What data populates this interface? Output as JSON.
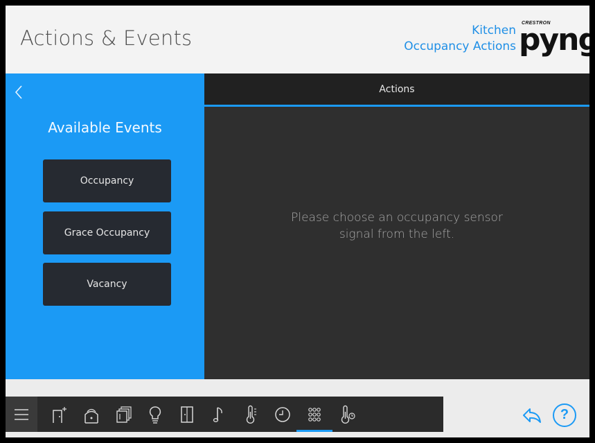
{
  "header": {
    "title": "Actions & Events",
    "room": "Kitchen",
    "subtitle": "Occupancy Actions",
    "logo_small": "CRESTRON",
    "logo_big": "pyng"
  },
  "left_panel": {
    "back_icon": "chevron-left-icon",
    "title": "Available Events",
    "events": [
      {
        "label": "Occupancy"
      },
      {
        "label": "Grace Occupancy"
      },
      {
        "label": "Vacancy"
      }
    ]
  },
  "right_panel": {
    "tab": "Actions",
    "message_line1": "Please choose an occupancy sensor",
    "message_line2": "signal from the left."
  },
  "bottom_nav": {
    "items": [
      {
        "icon": "menu-icon"
      },
      {
        "icon": "door-add-icon"
      },
      {
        "icon": "garage-icon"
      },
      {
        "icon": "shades-icon"
      },
      {
        "icon": "lightbulb-icon"
      },
      {
        "icon": "door-icon"
      },
      {
        "icon": "music-note-icon"
      },
      {
        "icon": "thermometer-icon"
      },
      {
        "icon": "clock-icon"
      },
      {
        "icon": "keypad-grid-icon",
        "active": true
      },
      {
        "icon": "thermostat-icon"
      }
    ],
    "share_icon": "share-icon",
    "help_label": "?"
  },
  "colors": {
    "accent": "#1b9af5",
    "dark_panel": "#2f2f2f",
    "button_dark": "#262a31"
  }
}
